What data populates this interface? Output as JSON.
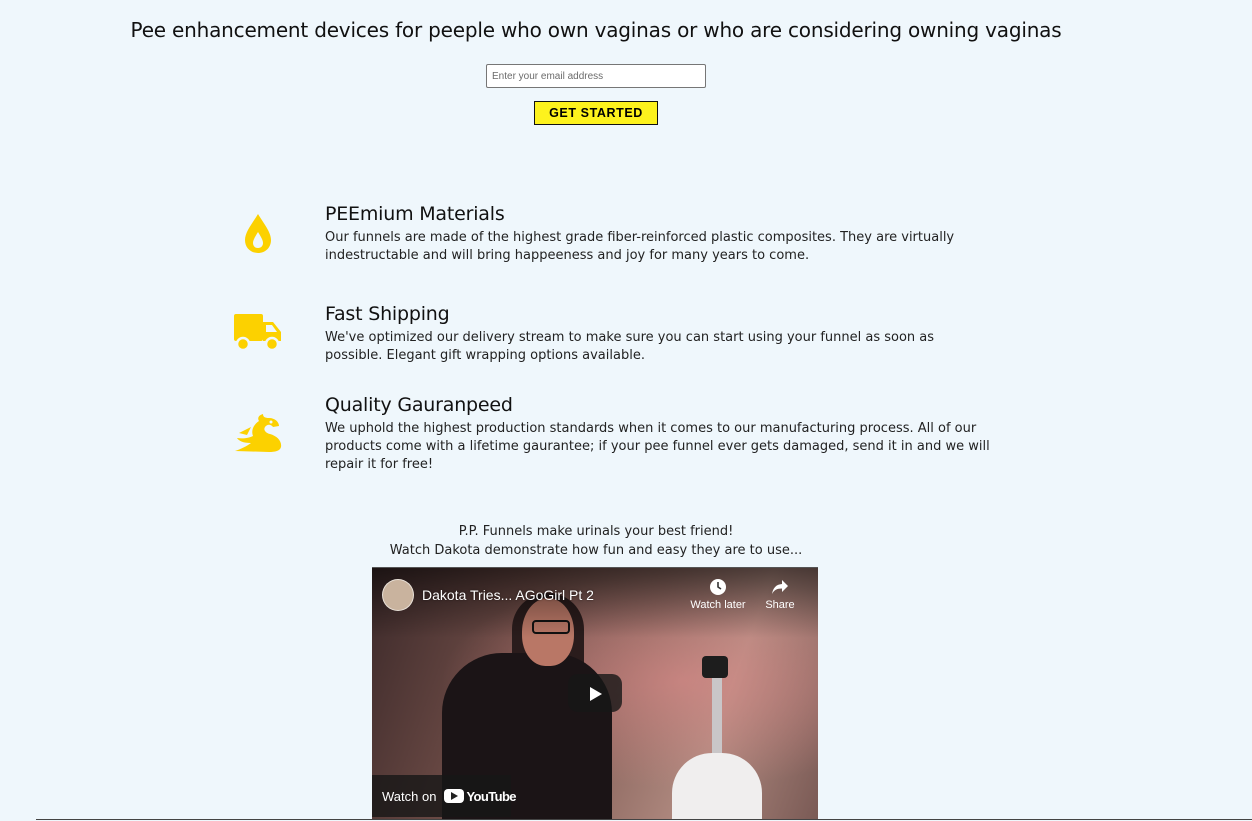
{
  "hero": {
    "headline": "Pee enhancement devices for peeple who own vaginas or who are considering owning vaginas",
    "email_placeholder": "Enter your email address",
    "email_value": "",
    "cta_label": "GET STARTED"
  },
  "features": [
    {
      "icon": "water-drop-icon",
      "title": "PEEmium Materials",
      "description": "Our funnels are made of the highest grade fiber-reinforced plastic composites. They are virtually indestructable and will bring happeeness and joy for many years to come."
    },
    {
      "icon": "truck-icon",
      "title": "Fast Shipping",
      "description": "We've optimized our delivery stream to make sure you can start using your funnel as soon as possible. Elegant gift wrapping options available."
    },
    {
      "icon": "dragon-icon",
      "title": "Quality Gauranpeed",
      "description": "We uphold the highest production standards when it comes to our manufacturing process. All of our products come with a lifetime gaurantee; if your pee funnel ever gets damaged, send it in and we will repair it for free!"
    }
  ],
  "video": {
    "caption_line1": "P.P. Funnels make urinals your best friend!",
    "caption_line2": "Watch Dakota demonstrate how fun and easy they are to use...",
    "title": "Dakota Tries... AGoGirl Pt 2",
    "watch_later_label": "Watch later",
    "share_label": "Share",
    "watch_on_label": "Watch on",
    "youtube_label": "YouTube"
  },
  "colors": {
    "background": "#eff7fc",
    "accent_yellow": "#fdf21d",
    "icon_yellow": "#fcd100"
  }
}
